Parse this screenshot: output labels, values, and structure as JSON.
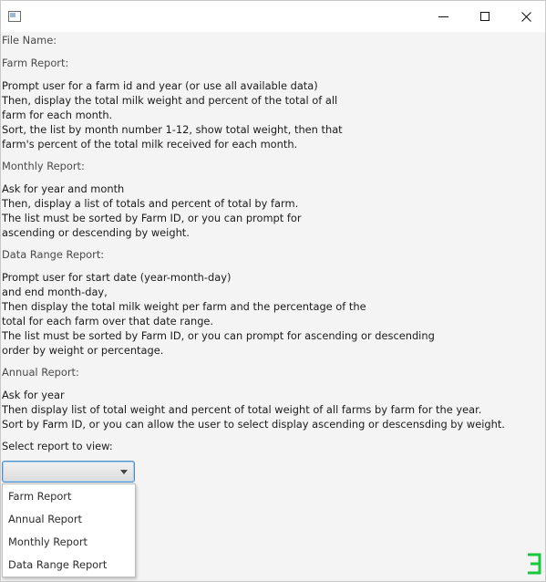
{
  "window": {
    "title": "",
    "controls": {
      "minimize": "minimize-icon",
      "maximize": "maximize-icon",
      "close": "close-icon"
    }
  },
  "content": {
    "file_name_label": "File Name:",
    "farm_report": {
      "heading": "Farm Report:",
      "lines": [
        "Prompt user for a farm id and year (or use all available data)",
        "Then, display the total milk weight and percent of the total of all",
        "farm for each month.",
        "Sort, the list by month number 1-12, show total weight, then that",
        "farm's percent of the total milk received for each month."
      ]
    },
    "monthly_report": {
      "heading": "Monthly Report:",
      "lines": [
        "Ask for year and month",
        "Then, display a list of totals and percent of total by farm.",
        "The list must be sorted by Farm ID, or you can prompt for",
        "ascending or descending by weight."
      ]
    },
    "data_range_report": {
      "heading": "Data Range Report:",
      "lines": [
        "Prompt user for start date (year-month-day)",
        "and end month-day,",
        "Then display the total milk weight per farm and the percentage of the",
        "total for each farm over that date range.",
        "The list must be sorted by Farm ID, or you can prompt for ascending or descending",
        "order by weight or percentage."
      ]
    },
    "annual_report": {
      "heading": "Annual Report:",
      "lines": [
        "Ask for year",
        "Then display list of total weight and percent of total weight of all farms by farm for the year.",
        "Sort by Farm ID, or you can allow the user to select display ascending or descensding by weight."
      ]
    },
    "select_label": "Select report to view:"
  },
  "report_select": {
    "selected_value": "",
    "options": [
      "Farm Report",
      "Annual Report",
      "Monthly Report",
      "Data Range Report"
    ]
  },
  "colors": {
    "combo_focus_border": "#4d8ec7",
    "corner_mark": "#19c83c"
  },
  "icons": {
    "app": "app-window-icon",
    "dropdown_arrow": "chevron-down-icon",
    "corner": "overlay-badge-icon"
  }
}
